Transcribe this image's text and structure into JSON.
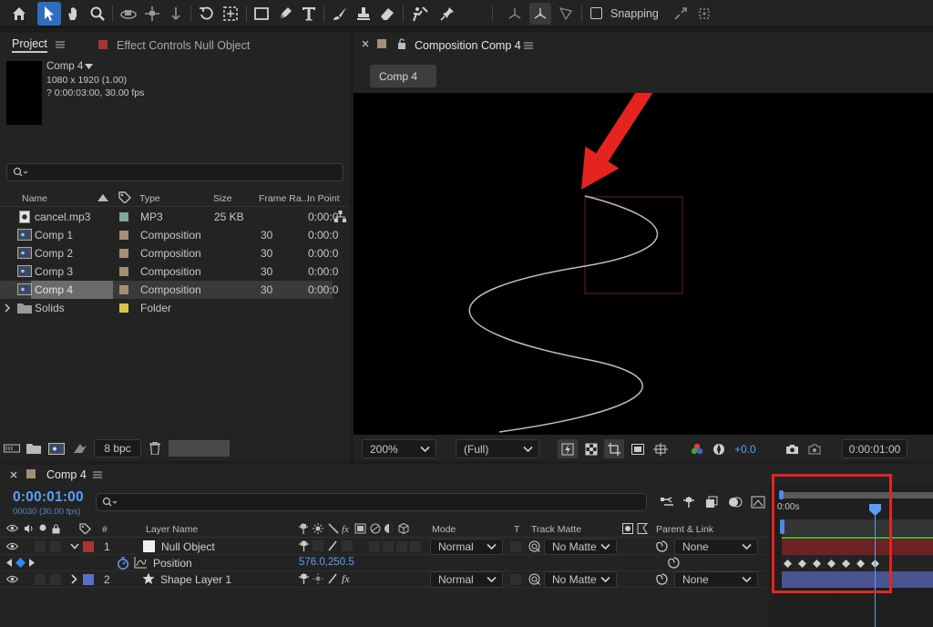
{
  "toolbar": {
    "snapping_label": "Snapping",
    "tools": [
      "home-icon",
      "selection-tool-icon",
      "hand-tool-icon",
      "zoom-tool-icon",
      "orbit-camera-icon",
      "pan-camera-icon",
      "dolly-camera-icon",
      "rotation-tool-icon",
      "pan-behind-icon",
      "rectangle-tool-icon",
      "pen-tool-icon",
      "type-tool-icon",
      "brush-tool-icon",
      "clone-stamp-icon",
      "eraser-icon",
      "roto-brush-icon",
      "puppet-pin-icon"
    ]
  },
  "project_panel": {
    "tab_project": "Project",
    "tab_effect_controls": "Effect Controls Null Object",
    "info": {
      "name": "Comp 4",
      "size": "1080 x 1920 (1.00)",
      "duration": "? 0:00:03:00, 30.00 fps"
    },
    "columns": [
      "Name",
      "Type",
      "Size",
      "Frame Ra...",
      "In Point"
    ],
    "items": [
      {
        "name": "cancel.mp3",
        "type": "MP3",
        "size": "25 KB",
        "fps": "",
        "in": "0:00:0",
        "label_color": "#7fa99a",
        "icon": "audio-file-icon"
      },
      {
        "name": "Comp 1",
        "type": "Composition",
        "size": "",
        "fps": "30",
        "in": "0:00:0",
        "label_color": "#a58f74",
        "icon": "composition-icon"
      },
      {
        "name": "Comp 2",
        "type": "Composition",
        "size": "",
        "fps": "30",
        "in": "0:00:0",
        "label_color": "#a58f74",
        "icon": "composition-icon"
      },
      {
        "name": "Comp 3",
        "type": "Composition",
        "size": "",
        "fps": "30",
        "in": "0:00:0",
        "label_color": "#a58f74",
        "icon": "composition-icon"
      },
      {
        "name": "Comp 4",
        "type": "Composition",
        "size": "",
        "fps": "30",
        "in": "0:00:0",
        "label_color": "#a58f74",
        "icon": "composition-icon",
        "selected": true
      },
      {
        "name": "Solids",
        "type": "Folder",
        "size": "",
        "fps": "",
        "in": "",
        "label_color": "#d6c34a",
        "icon": "folder-icon"
      }
    ],
    "bpc": "8 bpc"
  },
  "composition_panel": {
    "tab_label": "Composition Comp 4",
    "comp_button": "Comp 4",
    "zoom": "200%",
    "resolution": "(Full)",
    "exposure": "+0.0",
    "timecode": "0:00:01:00"
  },
  "timeline": {
    "tab_label": "Comp 4",
    "current_time": "0:00:01:00",
    "frame_info": "00030 (30.00 fps)",
    "ruler_start": "0:00s",
    "columns": {
      "layer_name": "Layer Name",
      "hash": "#",
      "mode": "Mode",
      "t": "T",
      "track_matte": "Track Matte",
      "parent": "Parent & Link"
    },
    "layers": [
      {
        "index": "1",
        "name": "Null Object",
        "mode": "Normal",
        "matte": "No Matte",
        "parent": "None",
        "label_color": "#a83535"
      },
      {
        "index": "2",
        "name": "Shape Layer 1",
        "mode": "Normal",
        "matte": "No Matte",
        "parent": "None",
        "label_color": "#5a6fc8"
      }
    ],
    "property": {
      "name": "Position",
      "value": "576.0,250.5"
    },
    "keyframe_count": 7
  },
  "colors": {
    "accent": "#2d8ceb",
    "annotation": "#e52420",
    "playhead": "#5b9ef6"
  }
}
